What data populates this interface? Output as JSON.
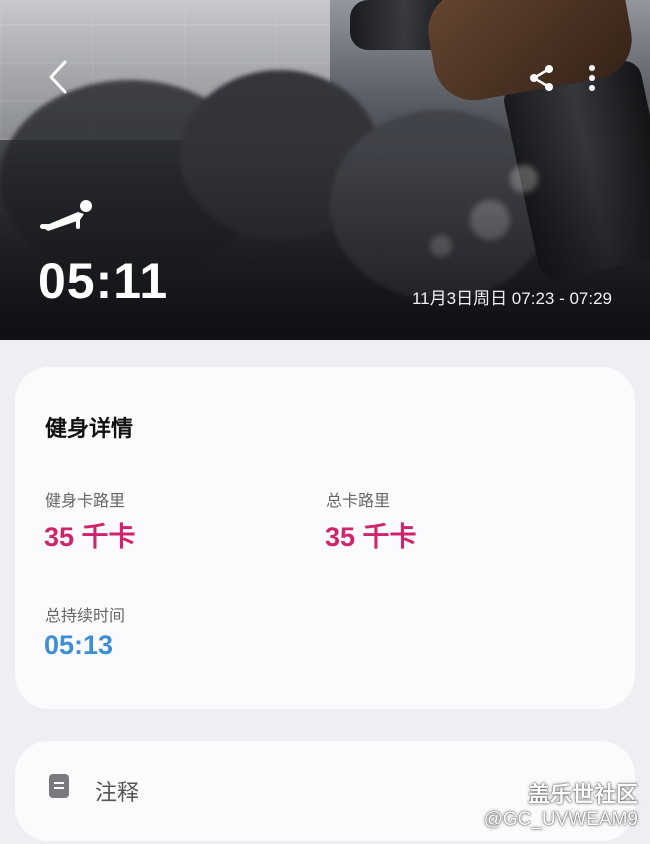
{
  "hero": {
    "duration": "05:11",
    "time_range": "11月3日周日 07:23 - 07:29"
  },
  "icons": {
    "back": "chevron-left-icon",
    "share": "share-icon",
    "more": "more-vertical-icon",
    "workout": "push-up-icon",
    "note": "note-icon"
  },
  "details": {
    "title": "健身详情",
    "stats": [
      {
        "label": "健身卡路里",
        "value": "35 千卡"
      },
      {
        "label": "总卡路里",
        "value": "35 千卡"
      },
      {
        "label": "总持续时间",
        "value": "05:13"
      }
    ]
  },
  "notes": {
    "label": "注释"
  },
  "watermark": {
    "line1": "盖乐世社区",
    "line2": "@GC_UVWEAM9"
  },
  "colors": {
    "calorie": "#d0236c",
    "duration": "#3c8fd8",
    "card_bg": "#fbfbfe",
    "page_bg": "#efeef3"
  }
}
